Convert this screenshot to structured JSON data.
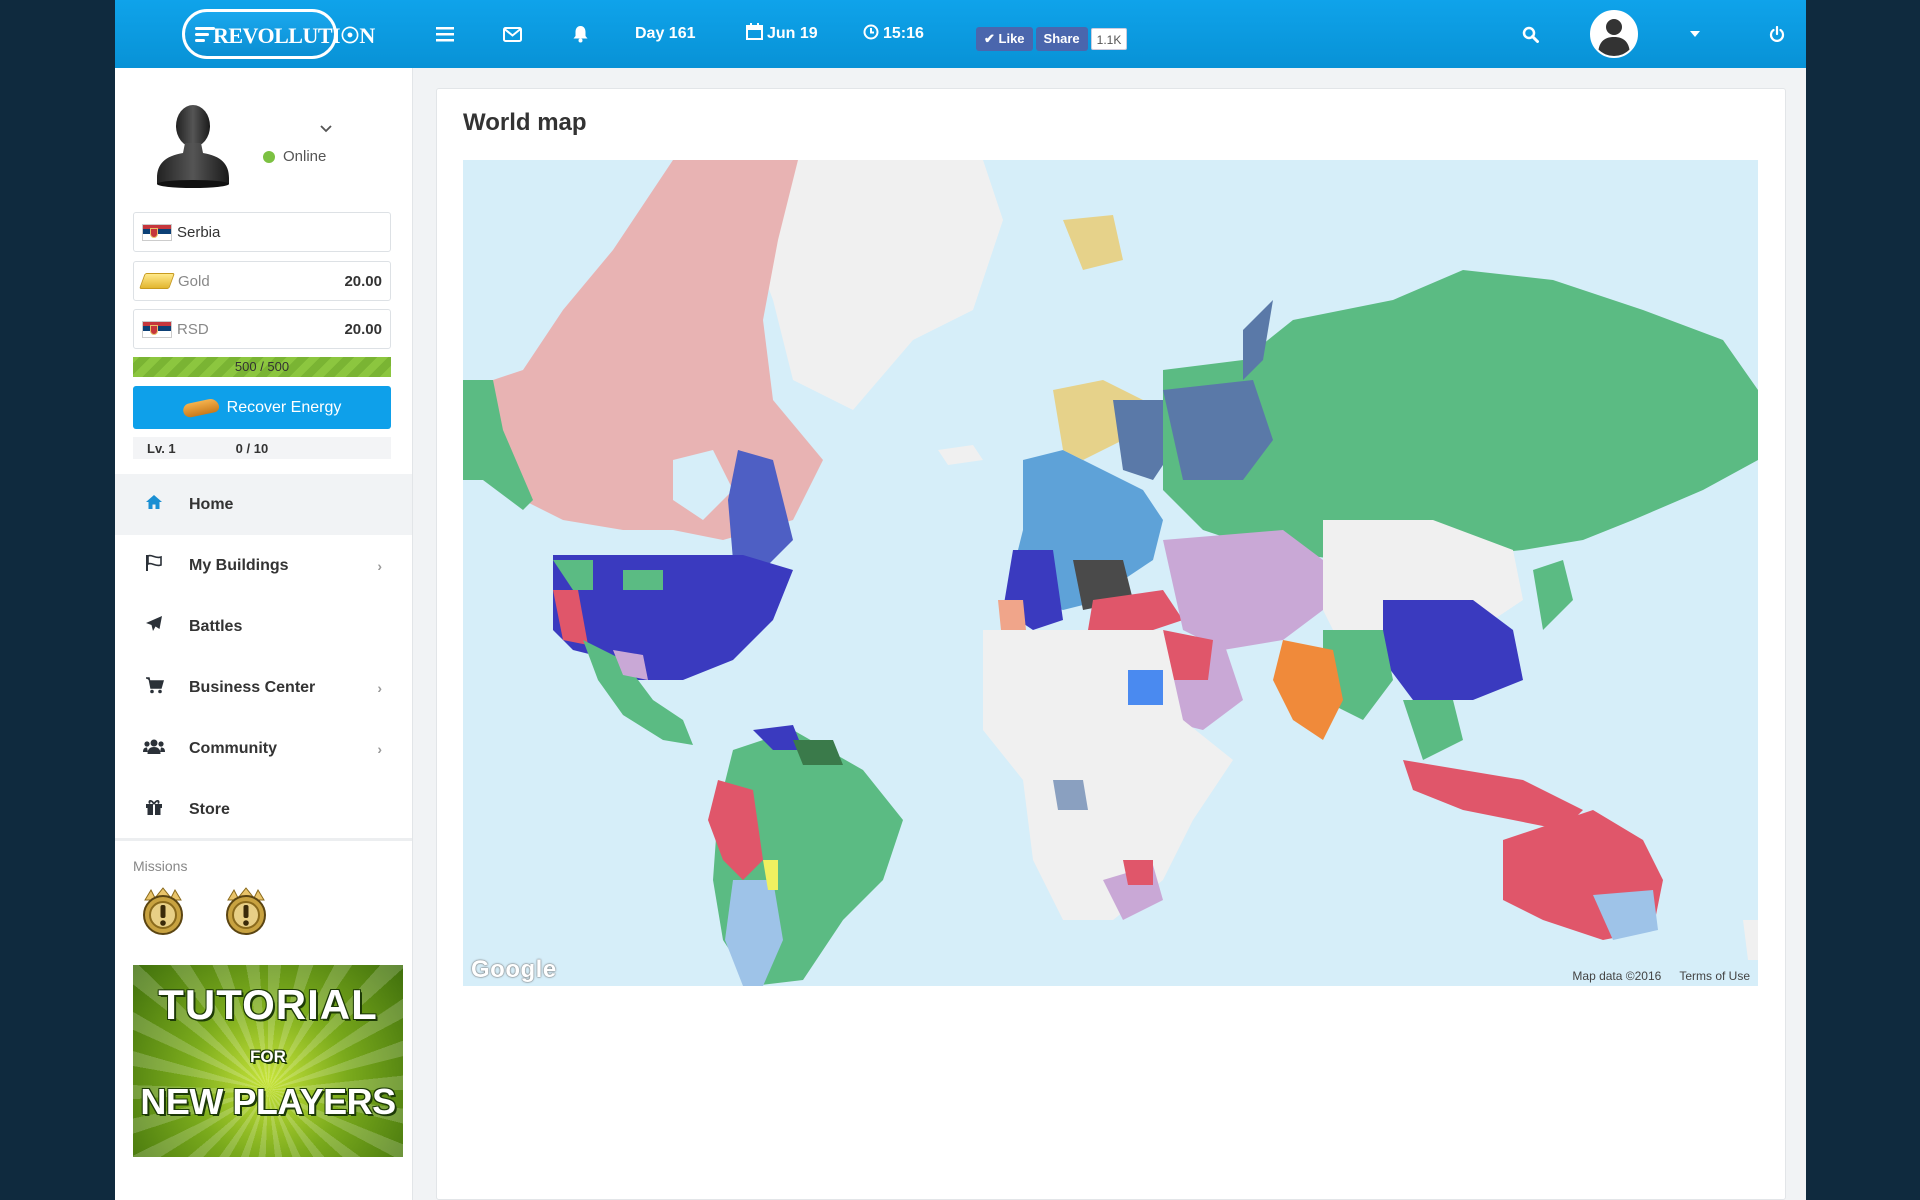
{
  "topbar": {
    "logo": "REVOLLUTI☉N",
    "day": "Day 161",
    "date": "Jun 19",
    "time": "15:16",
    "fb_like": "Like",
    "fb_share": "Share",
    "fb_count": "1.1K"
  },
  "profile": {
    "status": "Online",
    "country": "Serbia",
    "gold_label": "Gold",
    "gold_value": "20.00",
    "currency_label": "RSD",
    "currency_value": "20.00",
    "energy": "500 / 500",
    "energy_fraction": 1.0,
    "recover_label": "Recover Energy",
    "level": "Lv. 1",
    "xp": "0 / 10"
  },
  "nav": {
    "items": [
      {
        "label": "Home",
        "icon": "home-icon"
      },
      {
        "label": "My Buildings",
        "icon": "flag-icon"
      },
      {
        "label": "Battles",
        "icon": "paper-plane-icon"
      },
      {
        "label": "Business Center",
        "icon": "cart-icon"
      },
      {
        "label": "Community",
        "icon": "users-icon"
      },
      {
        "label": "Store",
        "icon": "gift-icon"
      }
    ]
  },
  "missions": {
    "label": "Missions"
  },
  "tutorial": {
    "line1": "TUTORIAL",
    "line2": "FOR",
    "line3": "NEW PLAYERS"
  },
  "main": {
    "title": "World map",
    "map_logo": "Google",
    "map_data": "Map data ©2016",
    "terms": "Terms of Use"
  },
  "colors": {
    "accent": "#0ea0ea",
    "online": "#7cc142",
    "energy_bar": "#8cc63f"
  }
}
